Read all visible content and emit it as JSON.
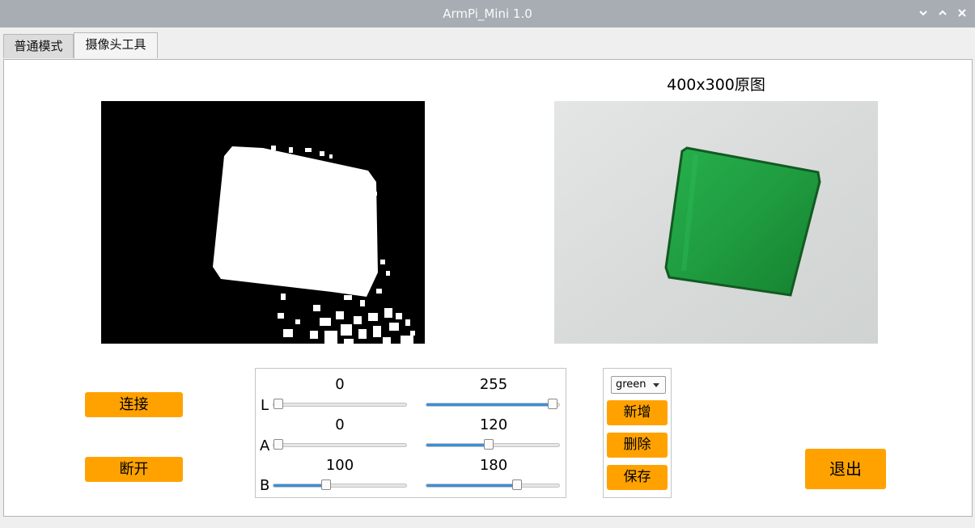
{
  "window": {
    "title": "ArmPi_Mini 1.0"
  },
  "titlebar_icons": [
    "minimize-icon",
    "maximize-icon",
    "close-icon"
  ],
  "tabs": [
    {
      "label": "普通模式"
    },
    {
      "label": "摄像头工具"
    }
  ],
  "preview": {
    "caption": "400x300原图"
  },
  "buttons": {
    "connect": "连接",
    "disconnect": "断开",
    "exit": "退出",
    "add": "新增",
    "delete": "删除",
    "save": "保存"
  },
  "color_select": {
    "value": "green"
  },
  "sliders": {
    "range_max": 255,
    "L": {
      "label": "L",
      "min": 0,
      "max": 255
    },
    "A": {
      "label": "A",
      "min": 0,
      "max": 120
    },
    "B": {
      "label": "B",
      "min": 100,
      "max": 180
    }
  },
  "colors": {
    "accent": "#ffa200",
    "slider_fill": "#3a8fd8",
    "titlebar": "#a7adb3"
  }
}
